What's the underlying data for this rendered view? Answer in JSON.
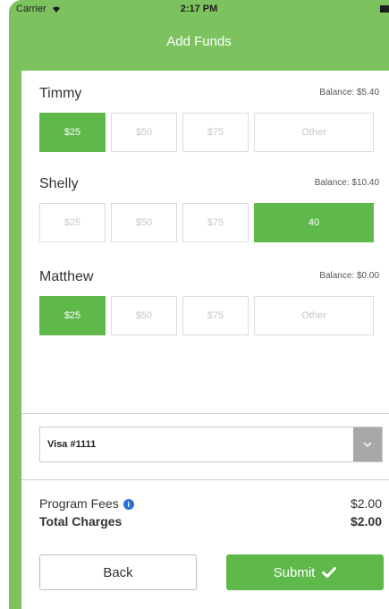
{
  "status_bar": {
    "carrier": "Carrier",
    "time": "2:17 PM"
  },
  "nav": {
    "title": "Add Funds"
  },
  "children": [
    {
      "name": "Timmy",
      "balance": "Balance: $5.40",
      "options": [
        "$25",
        "$50",
        "$75",
        "Other"
      ],
      "selected_option": "$25"
    },
    {
      "name": "Shelly",
      "balance": "Balance: $10.40",
      "options": [
        "$25",
        "$50",
        "$75",
        "40"
      ],
      "selected_option": "40"
    },
    {
      "name": "Matthew",
      "balance": "Balance: $0.00",
      "options": [
        "$25",
        "$50",
        "$75",
        "Other"
      ],
      "selected_option": "$25"
    }
  ],
  "payment": {
    "card_label": "Visa #1111"
  },
  "fees": {
    "program_fees_label": "Program Fees",
    "program_fees_value": "$2.00",
    "total_label": "Total Charges",
    "total_value": "$2.00"
  },
  "actions": {
    "back_label": "Back",
    "submit_label": "Submit"
  },
  "colors": {
    "accent_green": "#5fb84a",
    "header_green": "#7cc35f",
    "info_blue": "#2a6fd6"
  }
}
